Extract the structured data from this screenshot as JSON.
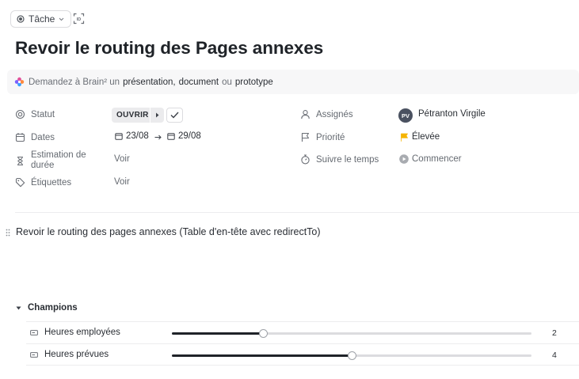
{
  "header": {
    "type_label": "Tâche",
    "title": "Revoir le routing des Pages annexes"
  },
  "brain": {
    "prefix": "Demandez à Brain² un",
    "opt1": "présentation,",
    "opt2": "document",
    "mid": "ou",
    "opt3": "prototype"
  },
  "fields": {
    "status": {
      "label": "Statut",
      "value": "OUVRIR"
    },
    "dates": {
      "label": "Dates",
      "start": "23/08",
      "end": "29/08"
    },
    "estimate": {
      "label_line1": "Estimation de",
      "label_line2": "durée",
      "value": "Voir"
    },
    "tags": {
      "label": "Étiquettes",
      "value": "Voir"
    },
    "assignees": {
      "label": "Assignés",
      "initials": "PV",
      "name": "Pétranton Virgile"
    },
    "priority": {
      "label": "Priorité",
      "value": "Élevée",
      "color": "#f5b400"
    },
    "time_tracking": {
      "label": "Suivre le temps",
      "value": "Commencer"
    }
  },
  "description": "Revoir le routing des pages annexes (Table d'en-tête avec redirectTo)",
  "champions": {
    "title": "Champions",
    "rows": [
      {
        "label": "Heures employées",
        "value": "2",
        "fraction": 0.255
      },
      {
        "label": "Heures prévues",
        "value": "4",
        "fraction": 0.5
      }
    ]
  }
}
